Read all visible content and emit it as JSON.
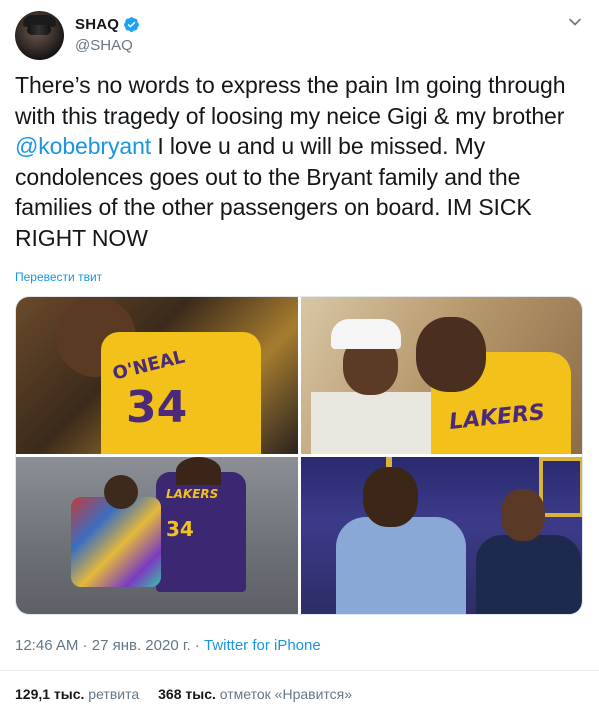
{
  "author": {
    "display_name": "SHAQ",
    "handle": "@SHAQ",
    "verified_icon": "verified-badge-icon",
    "avatar_icon": "avatar"
  },
  "tweet": {
    "text_before": "There’s no words to express the pain Im going through with this tragedy of loosing my neice Gigi & my brother ",
    "mention": "@kobebryant",
    "text_after": " I love u and u will be missed. My condolences goes out to the Bryant family and the families of the other passengers on board. IM SICK RIGHT NOW",
    "translate_label": "Перевести твит"
  },
  "photos": {
    "jersey1_name": "O'NEAL",
    "jersey1_number": "34",
    "jersey2_text": "LAKERS",
    "jersey3_text": "LAKERS",
    "jersey3_number": "34"
  },
  "meta": {
    "time": "12:46 AM",
    "separator1": " · ",
    "date": "27 янв. 2020 г.",
    "separator2": " · ",
    "source": "Twitter for iPhone"
  },
  "stats": {
    "retweets_count": "129,1 тыс.",
    "retweets_label": " ретвита",
    "likes_count": "368 тыс.",
    "likes_label": " отметок «Нравится»"
  },
  "colors": {
    "link": "#1b95e0",
    "muted": "#657786",
    "text": "#14171a"
  },
  "icons": {
    "caret": "chevron-down-icon"
  }
}
